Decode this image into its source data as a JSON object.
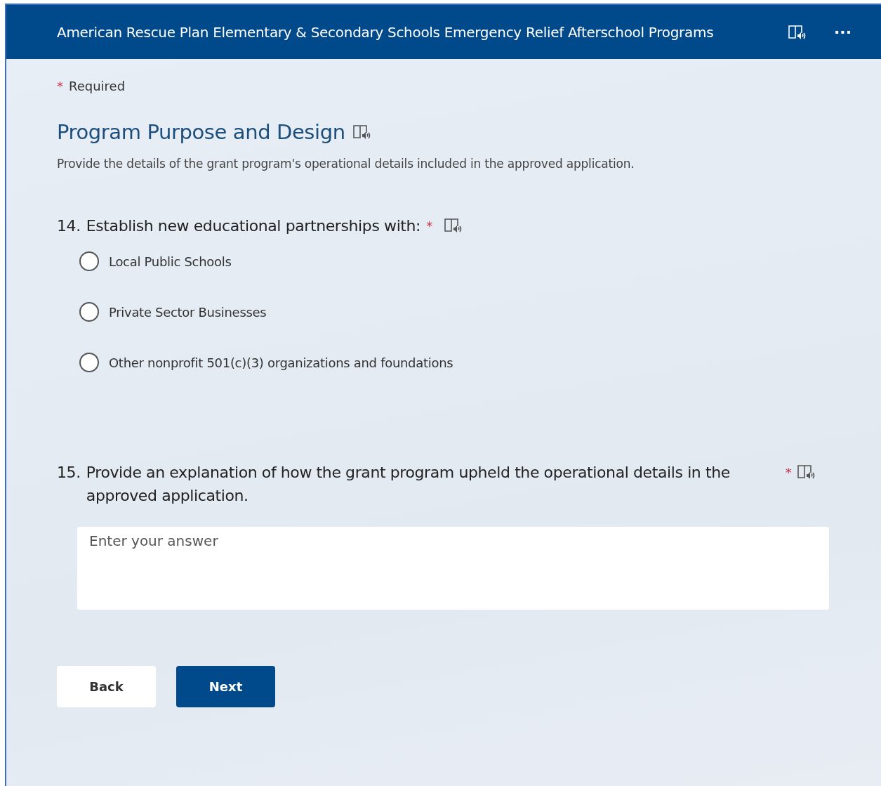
{
  "header": {
    "title": "American Rescue Plan Elementary & Secondary Schools Emergency Relief Afterschool Programs",
    "more": "···"
  },
  "required_note": {
    "mark": "*",
    "text": "Required"
  },
  "section": {
    "title": "Program Purpose and Design",
    "description": "Provide the details of the grant program's operational details included in the approved application."
  },
  "questions": [
    {
      "kind": "choice",
      "number": "14.",
      "text": "Establish new educational partnerships with:",
      "required_mark": "*",
      "options": [
        {
          "label": "Local Public Schools",
          "selected": false
        },
        {
          "label": "Private Sector Businesses",
          "selected": false
        },
        {
          "label": "Other nonprofit 501(c)(3) organizations and foundations",
          "selected": false
        }
      ]
    },
    {
      "kind": "text",
      "number": "15.",
      "text": "Provide an explanation of how the grant program upheld the operational details in the approved application.",
      "required_mark": "*",
      "placeholder": "Enter your answer"
    }
  ],
  "buttons": [
    {
      "label": "Back",
      "kind": "secondary"
    },
    {
      "label": "Next",
      "kind": "primary"
    }
  ]
}
